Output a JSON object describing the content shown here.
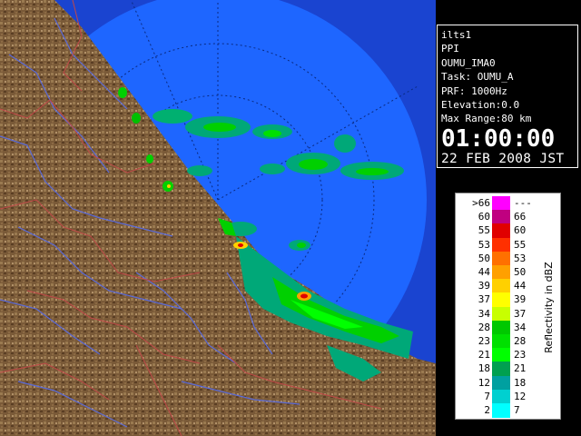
{
  "info": {
    "station": "ilts1",
    "scan_type": "PPI",
    "product": "OUMU_IMA0",
    "task": "Task: OUMU_A",
    "prf": "PRF: 1000Hz",
    "elevation": "Elevation:0.0",
    "max_range": "Max Range:80 km",
    "time": "01:00:00",
    "date": "22 FEB 2008 JST"
  },
  "legend": {
    "unit": "Reflectivity in dBZ",
    "rows": [
      {
        "lo": ">66",
        "hi": "---",
        "color": "#ff00ff"
      },
      {
        "lo": "60",
        "hi": "66",
        "color": "#c00080"
      },
      {
        "lo": "55",
        "hi": "60",
        "color": "#e00000"
      },
      {
        "lo": "53",
        "hi": "55",
        "color": "#ff3000"
      },
      {
        "lo": "50",
        "hi": "53",
        "color": "#ff7000"
      },
      {
        "lo": "44",
        "hi": "50",
        "color": "#ffa000"
      },
      {
        "lo": "39",
        "hi": "44",
        "color": "#ffd000"
      },
      {
        "lo": "37",
        "hi": "39",
        "color": "#ffff00"
      },
      {
        "lo": "34",
        "hi": "37",
        "color": "#c8ff00"
      },
      {
        "lo": "28",
        "hi": "34",
        "color": "#00c800"
      },
      {
        "lo": "23",
        "hi": "28",
        "color": "#00e000"
      },
      {
        "lo": "21",
        "hi": "23",
        "color": "#00ff00"
      },
      {
        "lo": "18",
        "hi": "21",
        "color": "#00a050"
      },
      {
        "lo": "12",
        "hi": "18",
        "color": "#00a0a0"
      },
      {
        "lo": "7",
        "hi": "12",
        "color": "#00d0d0"
      },
      {
        "lo": "2",
        "hi": "7",
        "color": "#00ffff"
      }
    ]
  },
  "colors": {
    "radar_range": "#1e66ff",
    "outer_area": "#1a44d0",
    "terrain": "#7a5a38",
    "rivers": "#5a6ad8",
    "borders": "#c04848"
  }
}
